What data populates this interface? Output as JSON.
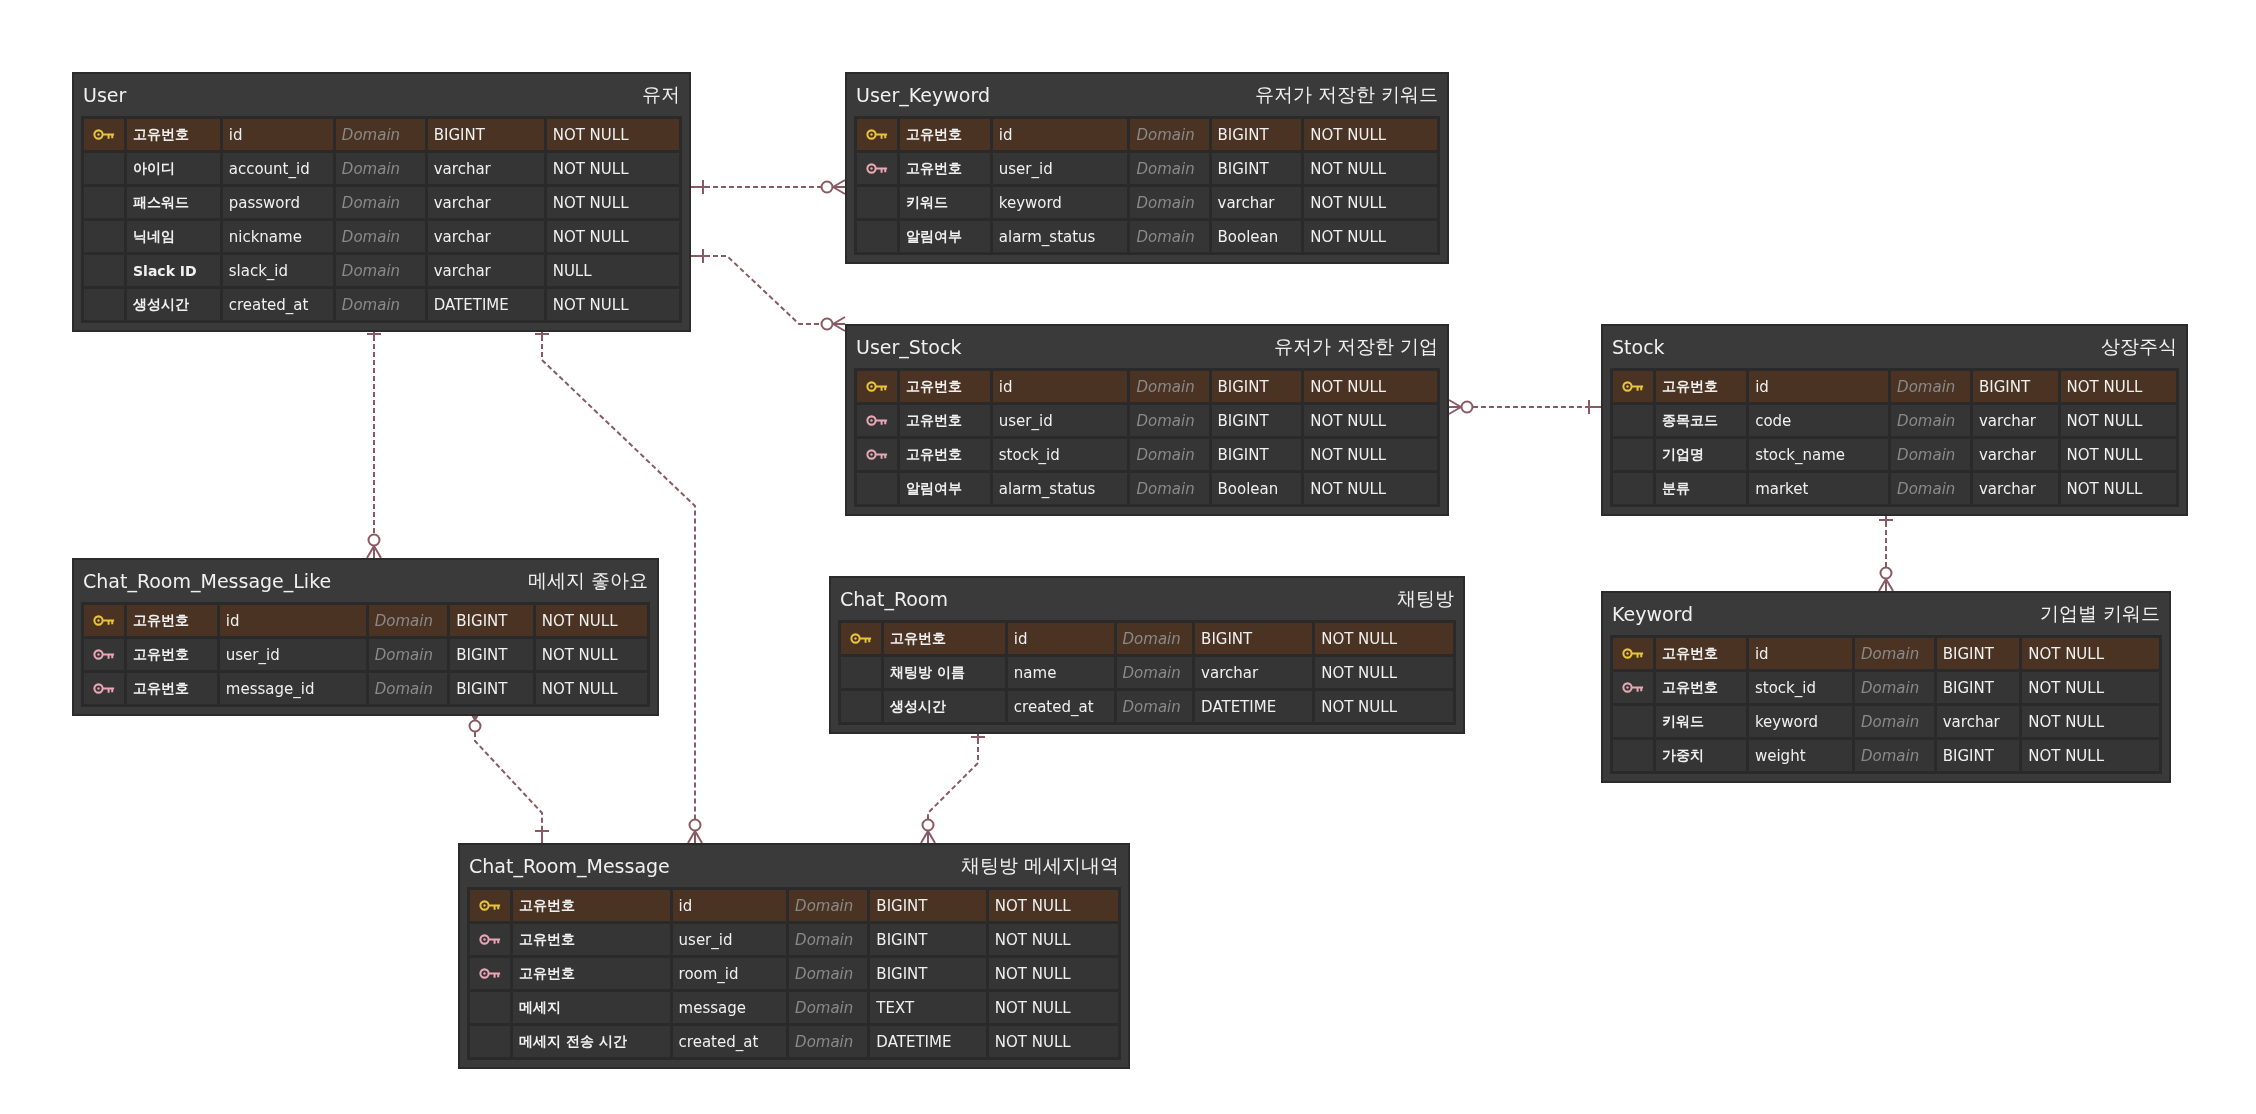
{
  "tables": [
    {
      "name": "User",
      "comment": "유저",
      "columns": [
        {
          "kind": "primary",
          "logical": "고유번호",
          "physical": "id",
          "domain": "Domain",
          "type": "BIGINT",
          "nullability": "NOT NULL"
        },
        {
          "kind": "none",
          "logical": "아이디",
          "physical": "account_id",
          "domain": "Domain",
          "type": "varchar",
          "nullability": "NOT NULL"
        },
        {
          "kind": "none",
          "logical": "패스워드",
          "physical": "password",
          "domain": "Domain",
          "type": "varchar",
          "nullability": "NOT NULL"
        },
        {
          "kind": "none",
          "logical": "닉네임",
          "physical": "nickname",
          "domain": "Domain",
          "type": "varchar",
          "nullability": "NOT NULL"
        },
        {
          "kind": "none",
          "logical": "Slack ID",
          "physical": "slack_id",
          "domain": "Domain",
          "type": "varchar",
          "nullability": "NULL"
        },
        {
          "kind": "none",
          "logical": "생성시간",
          "physical": "created_at",
          "domain": "Domain",
          "type": "DATETIME",
          "nullability": "NOT NULL"
        }
      ]
    },
    {
      "name": "User_Keyword",
      "comment": "유저가 저장한 키워드",
      "columns": [
        {
          "kind": "primary",
          "logical": "고유번호",
          "physical": "id",
          "domain": "Domain",
          "type": "BIGINT",
          "nullability": "NOT NULL"
        },
        {
          "kind": "foreign",
          "logical": "고유번호",
          "physical": "user_id",
          "domain": "Domain",
          "type": "BIGINT",
          "nullability": "NOT NULL"
        },
        {
          "kind": "none",
          "logical": "키워드",
          "physical": "keyword",
          "domain": "Domain",
          "type": "varchar",
          "nullability": "NOT NULL"
        },
        {
          "kind": "none",
          "logical": "알림여부",
          "physical": "alarm_status",
          "domain": "Domain",
          "type": "Boolean",
          "nullability": "NOT NULL"
        }
      ]
    },
    {
      "name": "User_Stock",
      "comment": "유저가 저장한 기업",
      "columns": [
        {
          "kind": "primary",
          "logical": "고유번호",
          "physical": "id",
          "domain": "Domain",
          "type": "BIGINT",
          "nullability": "NOT NULL"
        },
        {
          "kind": "foreign",
          "logical": "고유번호",
          "physical": "user_id",
          "domain": "Domain",
          "type": "BIGINT",
          "nullability": "NOT NULL"
        },
        {
          "kind": "foreign",
          "logical": "고유번호",
          "physical": "stock_id",
          "domain": "Domain",
          "type": "BIGINT",
          "nullability": "NOT NULL"
        },
        {
          "kind": "none",
          "logical": "알림여부",
          "physical": "alarm_status",
          "domain": "Domain",
          "type": "Boolean",
          "nullability": "NOT NULL"
        }
      ]
    },
    {
      "name": "Stock",
      "comment": "상장주식",
      "columns": [
        {
          "kind": "primary",
          "logical": "고유번호",
          "physical": "id",
          "domain": "Domain",
          "type": "BIGINT",
          "nullability": "NOT NULL"
        },
        {
          "kind": "none",
          "logical": "종목코드",
          "physical": "code",
          "domain": "Domain",
          "type": "varchar",
          "nullability": "NOT NULL"
        },
        {
          "kind": "none",
          "logical": "기업명",
          "physical": "stock_name",
          "domain": "Domain",
          "type": "varchar",
          "nullability": "NOT NULL"
        },
        {
          "kind": "none",
          "logical": "분류",
          "physical": "market",
          "domain": "Domain",
          "type": "varchar",
          "nullability": "NOT NULL"
        }
      ]
    },
    {
      "name": "Chat_Room_Message_Like",
      "comment": "메세지 좋아요",
      "columns": [
        {
          "kind": "primary",
          "logical": "고유번호",
          "physical": "id",
          "domain": "Domain",
          "type": "BIGINT",
          "nullability": "NOT NULL"
        },
        {
          "kind": "foreign",
          "logical": "고유번호",
          "physical": "user_id",
          "domain": "Domain",
          "type": "BIGINT",
          "nullability": "NOT NULL"
        },
        {
          "kind": "foreign",
          "logical": "고유번호",
          "physical": "message_id",
          "domain": "Domain",
          "type": "BIGINT",
          "nullability": "NOT NULL"
        }
      ]
    },
    {
      "name": "Chat_Room",
      "comment": "채팅방",
      "columns": [
        {
          "kind": "primary",
          "logical": "고유번호",
          "physical": "id",
          "domain": "Domain",
          "type": "BIGINT",
          "nullability": "NOT NULL"
        },
        {
          "kind": "none",
          "logical": "채팅방 이름",
          "physical": "name",
          "domain": "Domain",
          "type": "varchar",
          "nullability": "NOT NULL"
        },
        {
          "kind": "none",
          "logical": "생성시간",
          "physical": "created_at",
          "domain": "Domain",
          "type": "DATETIME",
          "nullability": "NOT NULL"
        }
      ]
    },
    {
      "name": "Keyword",
      "comment": "기업별 키워드",
      "columns": [
        {
          "kind": "primary",
          "logical": "고유번호",
          "physical": "id",
          "domain": "Domain",
          "type": "BIGINT",
          "nullability": "NOT NULL"
        },
        {
          "kind": "foreign",
          "logical": "고유번호",
          "physical": "stock_id",
          "domain": "Domain",
          "type": "BIGINT",
          "nullability": "NOT NULL"
        },
        {
          "kind": "none",
          "logical": "키워드",
          "physical": "keyword",
          "domain": "Domain",
          "type": "varchar",
          "nullability": "NOT NULL"
        },
        {
          "kind": "none",
          "logical": "가중치",
          "physical": "weight",
          "domain": "Domain",
          "type": "BIGINT",
          "nullability": "NOT NULL"
        }
      ]
    },
    {
      "name": "Chat_Room_Message",
      "comment": "채팅방 메세지내역",
      "columns": [
        {
          "kind": "primary",
          "logical": "고유번호",
          "physical": "id",
          "domain": "Domain",
          "type": "BIGINT",
          "nullability": "NOT NULL"
        },
        {
          "kind": "foreign",
          "logical": "고유번호",
          "physical": "user_id",
          "domain": "Domain",
          "type": "BIGINT",
          "nullability": "NOT NULL"
        },
        {
          "kind": "foreign",
          "logical": "고유번호",
          "physical": "room_id",
          "domain": "Domain",
          "type": "BIGINT",
          "nullability": "NOT NULL"
        },
        {
          "kind": "none",
          "logical": "메세지",
          "physical": "message",
          "domain": "Domain",
          "type": "TEXT",
          "nullability": "NOT NULL"
        },
        {
          "kind": "none",
          "logical": "메세지 전송 시간",
          "physical": "created_at",
          "domain": "Domain",
          "type": "DATETIME",
          "nullability": "NOT NULL"
        }
      ]
    }
  ]
}
